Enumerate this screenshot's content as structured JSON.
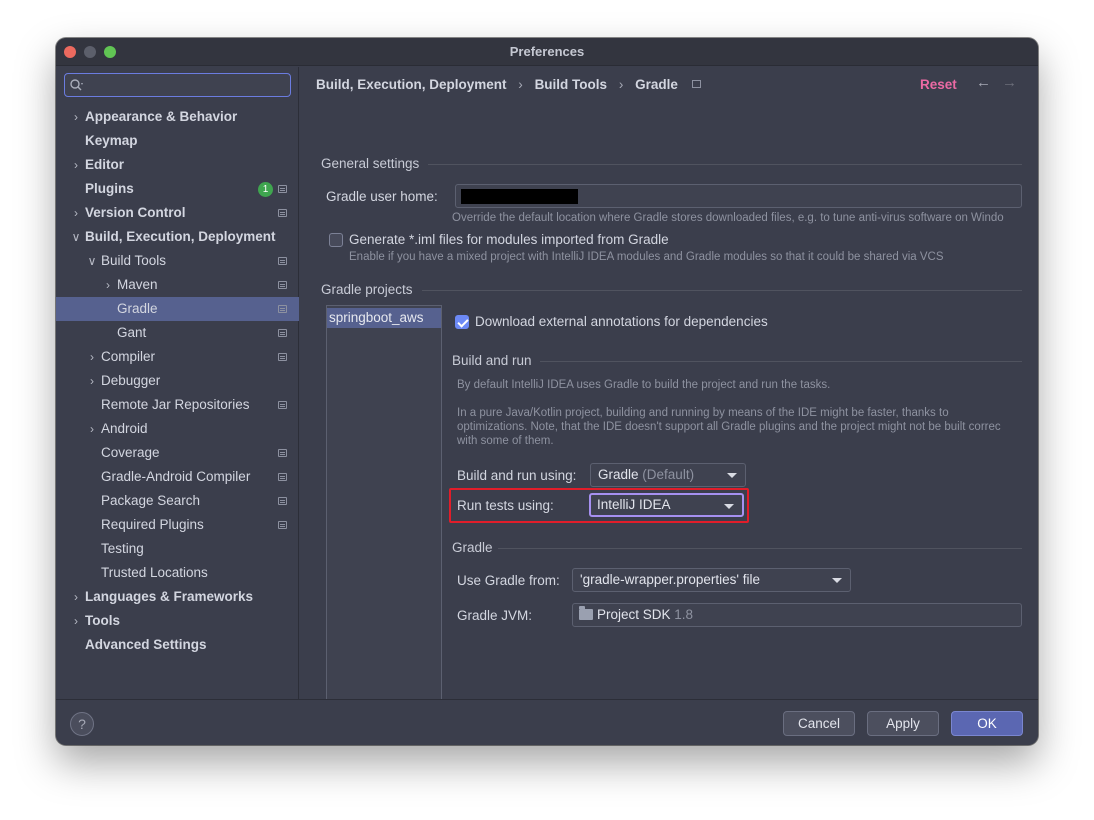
{
  "window": {
    "title": "Preferences"
  },
  "search": {
    "placeholder": ""
  },
  "sidebar": {
    "items": [
      {
        "label": "Appearance & Behavior",
        "bold": true,
        "indent": 0,
        "chevron": ">",
        "gear": false,
        "badge": ""
      },
      {
        "label": "Keymap",
        "bold": true,
        "indent": 0,
        "chevron": "",
        "gear": false,
        "badge": ""
      },
      {
        "label": "Editor",
        "bold": true,
        "indent": 0,
        "chevron": ">",
        "gear": false,
        "badge": ""
      },
      {
        "label": "Plugins",
        "bold": true,
        "indent": 0,
        "chevron": "",
        "gear": true,
        "badge": "1"
      },
      {
        "label": "Version Control",
        "bold": true,
        "indent": 0,
        "chevron": ">",
        "gear": true,
        "badge": ""
      },
      {
        "label": "Build, Execution, Deployment",
        "bold": true,
        "indent": 0,
        "chevron": "v",
        "gear": false,
        "badge": ""
      },
      {
        "label": "Build Tools",
        "bold": false,
        "indent": 1,
        "chevron": "v",
        "gear": true,
        "badge": ""
      },
      {
        "label": "Maven",
        "bold": false,
        "indent": 2,
        "chevron": ">",
        "gear": true,
        "badge": ""
      },
      {
        "label": "Gradle",
        "bold": false,
        "indent": 2,
        "chevron": "",
        "gear": true,
        "badge": "",
        "selected": true
      },
      {
        "label": "Gant",
        "bold": false,
        "indent": 2,
        "chevron": "",
        "gear": true,
        "badge": ""
      },
      {
        "label": "Compiler",
        "bold": false,
        "indent": 1,
        "chevron": ">",
        "gear": true,
        "badge": ""
      },
      {
        "label": "Debugger",
        "bold": false,
        "indent": 1,
        "chevron": ">",
        "gear": false,
        "badge": ""
      },
      {
        "label": "Remote Jar Repositories",
        "bold": false,
        "indent": 1,
        "chevron": "",
        "gear": true,
        "badge": ""
      },
      {
        "label": "Android",
        "bold": false,
        "indent": 1,
        "chevron": ">",
        "gear": false,
        "badge": ""
      },
      {
        "label": "Coverage",
        "bold": false,
        "indent": 1,
        "chevron": "",
        "gear": true,
        "badge": ""
      },
      {
        "label": "Gradle-Android Compiler",
        "bold": false,
        "indent": 1,
        "chevron": "",
        "gear": true,
        "badge": ""
      },
      {
        "label": "Package Search",
        "bold": false,
        "indent": 1,
        "chevron": "",
        "gear": true,
        "badge": ""
      },
      {
        "label": "Required Plugins",
        "bold": false,
        "indent": 1,
        "chevron": "",
        "gear": true,
        "badge": ""
      },
      {
        "label": "Testing",
        "bold": false,
        "indent": 1,
        "chevron": "",
        "gear": false,
        "badge": ""
      },
      {
        "label": "Trusted Locations",
        "bold": false,
        "indent": 1,
        "chevron": "",
        "gear": false,
        "badge": ""
      },
      {
        "label": "Languages & Frameworks",
        "bold": true,
        "indent": 0,
        "chevron": ">",
        "gear": false,
        "badge": ""
      },
      {
        "label": "Tools",
        "bold": true,
        "indent": 0,
        "chevron": ">",
        "gear": false,
        "badge": ""
      },
      {
        "label": "Advanced Settings",
        "bold": true,
        "indent": 0,
        "chevron": "",
        "gear": false,
        "badge": ""
      }
    ]
  },
  "breadcrumb": {
    "items": [
      "Build, Execution, Deployment",
      "Build Tools",
      "Gradle"
    ],
    "separator": "›"
  },
  "header": {
    "reset": "Reset",
    "back": "←",
    "forward": "→"
  },
  "general": {
    "title": "General settings",
    "user_home_label": "Gradle user home:",
    "user_home_hint": "Override the default location where Gradle stores downloaded files, e.g. to tune anti-virus software on Windo",
    "generate_iml_label": "Generate *.iml files for modules imported from Gradle",
    "generate_iml_checked": false,
    "generate_iml_hint": "Enable if you have a mixed project with IntelliJ IDEA modules and Gradle modules so that it could be shared via VCS"
  },
  "projects": {
    "title": "Gradle projects",
    "list": [
      "springboot_aws"
    ],
    "download_annotations_label": "Download external annotations for dependencies",
    "download_annotations_checked": true
  },
  "build_run": {
    "title": "Build and run",
    "desc1": "By default IntelliJ IDEA uses Gradle to build the project and run the tasks.",
    "desc2_line1": "In a pure Java/Kotlin project, building and running by means of the IDE might be faster, thanks to",
    "desc2_line2": "optimizations. Note, that the IDE doesn't support all Gradle plugins and the project might not be built correc",
    "desc2_line3": "with some of them.",
    "build_using_label": "Build and run using:",
    "build_using_value": "Gradle",
    "build_using_suffix": "(Default)",
    "run_tests_label": "Run tests using:",
    "run_tests_value": "IntelliJ IDEA"
  },
  "gradle": {
    "title": "Gradle",
    "use_from_label": "Use Gradle from:",
    "use_from_value": "'gradle-wrapper.properties' file",
    "jvm_label": "Gradle JVM:",
    "jvm_value": "Project SDK",
    "jvm_version": "1.8"
  },
  "footer": {
    "help": "?",
    "cancel": "Cancel",
    "apply": "Apply",
    "ok": "OK"
  },
  "colors": {
    "accent": "#56618f",
    "reset": "#ec6aa4",
    "highlight": "#e11d2a",
    "badge": "#3fa54f"
  }
}
